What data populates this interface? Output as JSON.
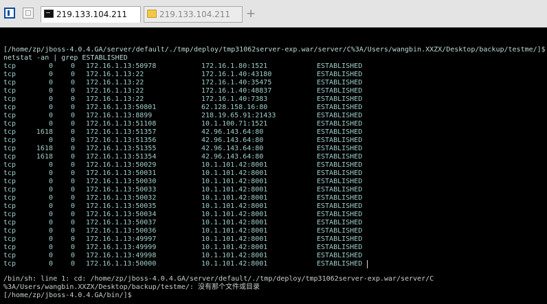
{
  "tabs": [
    {
      "label": "219.133.104.211",
      "icon": "terminal-icon",
      "active": true
    },
    {
      "label": "219.133.104.211",
      "icon": "folder-icon",
      "active": false
    }
  ],
  "add_tab_label": "+",
  "terminal": {
    "prompt_line1": "[/home/zp/jboss-4.0.4.GA/server/default/./tmp/deploy/tmp31062server-exp.war/server/C%3A/Users/wangbin.XXZX/Desktop/backup/testme/]$",
    "prompt_line2": "netstat -an | grep ESTABLISHED",
    "rows": [
      {
        "proto": "tcp",
        "recv": "0",
        "send": "0",
        "local": "172.16.1.13:50978",
        "foreign": "172.16.1.80:1521",
        "state": "ESTABLISHED"
      },
      {
        "proto": "tcp",
        "recv": "0",
        "send": "0",
        "local": "172.16.1.13:22",
        "foreign": "172.16.1.40:43180",
        "state": "ESTABLISHED"
      },
      {
        "proto": "tcp",
        "recv": "0",
        "send": "0",
        "local": "172.16.1.13:22",
        "foreign": "172.16.1.40:35475",
        "state": "ESTABLISHED"
      },
      {
        "proto": "tcp",
        "recv": "0",
        "send": "0",
        "local": "172.16.1.13:22",
        "foreign": "172.16.1.40:48837",
        "state": "ESTABLISHED"
      },
      {
        "proto": "tcp",
        "recv": "0",
        "send": "0",
        "local": "172.16.1.13:22",
        "foreign": "172.16.1.40:7383",
        "state": "ESTABLISHED"
      },
      {
        "proto": "tcp",
        "recv": "0",
        "send": "0",
        "local": "172.16.1.13:50801",
        "foreign": "62.128.158.16:80",
        "state": "ESTABLISHED"
      },
      {
        "proto": "tcp",
        "recv": "0",
        "send": "0",
        "local": "172.16.1.13:8899",
        "foreign": "218.19.65.91:21433",
        "state": "ESTABLISHED"
      },
      {
        "proto": "tcp",
        "recv": "0",
        "send": "0",
        "local": "172.16.1.13:51108",
        "foreign": "10.1.100.71:1521",
        "state": "ESTABLISHED"
      },
      {
        "proto": "tcp",
        "recv": "1618",
        "send": "0",
        "local": "172.16.1.13:51357",
        "foreign": "42.96.143.64:80",
        "state": "ESTABLISHED"
      },
      {
        "proto": "tcp",
        "recv": "0",
        "send": "0",
        "local": "172.16.1.13:51356",
        "foreign": "42.96.143.64:80",
        "state": "ESTABLISHED"
      },
      {
        "proto": "tcp",
        "recv": "1618",
        "send": "0",
        "local": "172.16.1.13:51355",
        "foreign": "42.96.143.64:80",
        "state": "ESTABLISHED"
      },
      {
        "proto": "tcp",
        "recv": "1618",
        "send": "0",
        "local": "172.16.1.13:51354",
        "foreign": "42.96.143.64:80",
        "state": "ESTABLISHED"
      },
      {
        "proto": "tcp",
        "recv": "0",
        "send": "0",
        "local": "172.16.1.13:50029",
        "foreign": "10.1.101.42:8001",
        "state": "ESTABLISHED"
      },
      {
        "proto": "tcp",
        "recv": "0",
        "send": "0",
        "local": "172.16.1.13:50031",
        "foreign": "10.1.101.42:8001",
        "state": "ESTABLISHED"
      },
      {
        "proto": "tcp",
        "recv": "0",
        "send": "0",
        "local": "172.16.1.13:50030",
        "foreign": "10.1.101.42:8001",
        "state": "ESTABLISHED"
      },
      {
        "proto": "tcp",
        "recv": "0",
        "send": "0",
        "local": "172.16.1.13:50033",
        "foreign": "10.1.101.42:8001",
        "state": "ESTABLISHED"
      },
      {
        "proto": "tcp",
        "recv": "0",
        "send": "0",
        "local": "172.16.1.13:50032",
        "foreign": "10.1.101.42:8001",
        "state": "ESTABLISHED"
      },
      {
        "proto": "tcp",
        "recv": "0",
        "send": "0",
        "local": "172.16.1.13:50035",
        "foreign": "10.1.101.42:8001",
        "state": "ESTABLISHED"
      },
      {
        "proto": "tcp",
        "recv": "0",
        "send": "0",
        "local": "172.16.1.13:50034",
        "foreign": "10.1.101.42:8001",
        "state": "ESTABLISHED"
      },
      {
        "proto": "tcp",
        "recv": "0",
        "send": "0",
        "local": "172.16.1.13:50037",
        "foreign": "10.1.101.42:8001",
        "state": "ESTABLISHED"
      },
      {
        "proto": "tcp",
        "recv": "0",
        "send": "0",
        "local": "172.16.1.13:50036",
        "foreign": "10.1.101.42:8001",
        "state": "ESTABLISHED"
      },
      {
        "proto": "tcp",
        "recv": "0",
        "send": "0",
        "local": "172.16.1.13:49997",
        "foreign": "10.1.101.42:8001",
        "state": "ESTABLISHED"
      },
      {
        "proto": "tcp",
        "recv": "0",
        "send": "0",
        "local": "172.16.1.13:49999",
        "foreign": "10.1.101.42:8001",
        "state": "ESTABLISHED"
      },
      {
        "proto": "tcp",
        "recv": "0",
        "send": "0",
        "local": "172.16.1.13:49998",
        "foreign": "10.1.101.42:8001",
        "state": "ESTABLISHED"
      },
      {
        "proto": "tcp",
        "recv": "0",
        "send": "0",
        "local": "172.16.1.13:50000",
        "foreign": "10.1.101.42:8001",
        "state": "ESTABLISHED"
      }
    ],
    "error_line1": "/bin/sh: line 1: cd: /home/zp/jboss-4.0.4.GA/server/default/./tmp/deploy/tmp31062server-exp.war/server/C",
    "error_line2": "%3A/Users/wangbin.XXZX/Desktop/backup/testme/: 没有那个文件或目录",
    "next_prompt": "[/home/zp/jboss-4.0.4.GA/bin/]$"
  }
}
